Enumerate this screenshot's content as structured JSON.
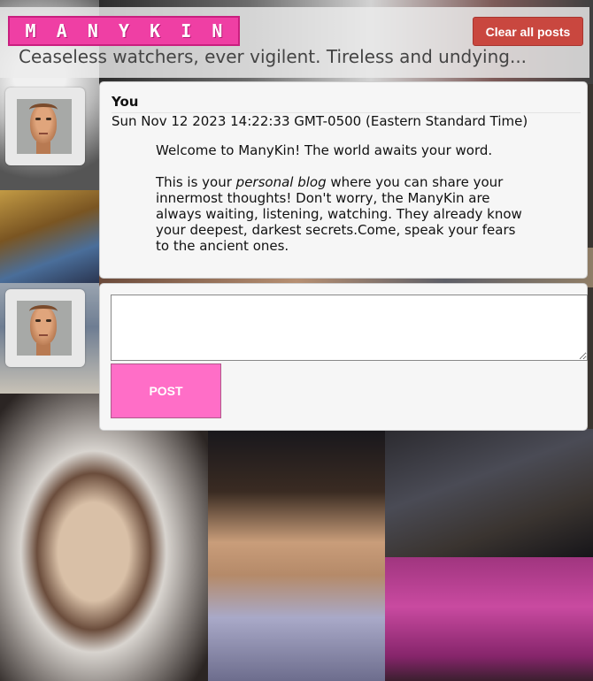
{
  "header": {
    "logo_letters": [
      "M",
      "A",
      "N",
      "Y",
      "K",
      "I",
      "N"
    ],
    "logo_text": "MANYKIN",
    "tagline": "Ceaseless watchers, ever vigilent. Tireless and undying...",
    "clear_label": "Clear all posts"
  },
  "post": {
    "author": "You",
    "timestamp": "Sun Nov 12 2023 14:22:33 GMT-0500 (Eastern Standard Time)",
    "paragraph1": "Welcome to ManyKin! The world awaits your word.",
    "paragraph2_before": "This is your ",
    "paragraph2_emphasis": "personal blog",
    "paragraph2_after": " where you can share your innermost thoughts! Don't worry, the ManyKin are always waiting, listening, watching. They already know your deepest, darkest secrets.Come, speak your fears to the ancient ones."
  },
  "compose": {
    "input_value": "",
    "post_label": "POST"
  },
  "colors": {
    "logo_pink": "#ef3fa4",
    "clear_button": "#c9473f",
    "post_button": "#ff6ec7"
  }
}
